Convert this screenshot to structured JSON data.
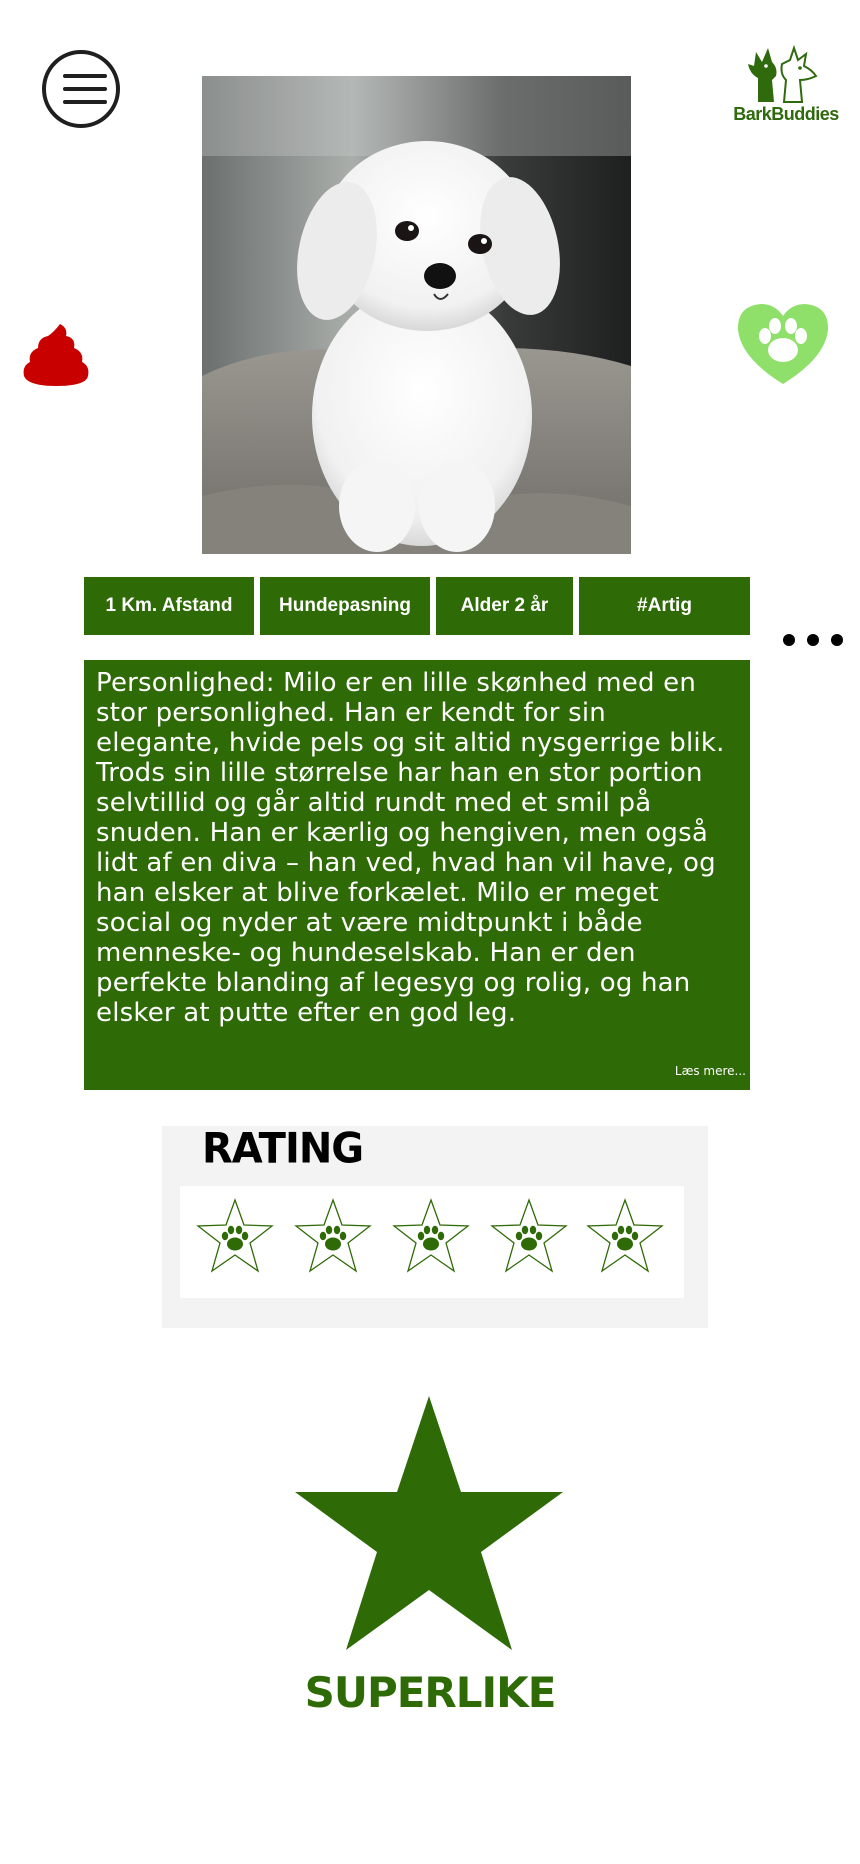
{
  "header": {
    "menu_icon": "hamburger-menu-icon",
    "logo_text": "BarkBuddies",
    "logo_color": "#2f6a0c"
  },
  "profile": {
    "photo_subject": "dog-photo",
    "tags": [
      {
        "label": "1 Km. Afstand"
      },
      {
        "label": "Hundepasning"
      },
      {
        "label": "Alder 2 år"
      },
      {
        "label": "#Artig"
      }
    ],
    "description": "Personlighed: Milo er en lille skønhed med en stor personlighed. Han er kendt for sin elegante, hvide pels og sit altid nysgerrige blik. Trods sin lille størrelse har han en stor portion selvtillid og går altid rundt med et smil på snuden. Han er kærlig og hengiven, men også lidt af en diva – han ved, hvad han vil have, og han elsker at blive forkælet. Milo er meget social og nyder at være midtpunkt i både menneske- og hundeselskab. Han er den perfekte blanding af legesyg og rolig, og han elsker at putte efter en god leg.",
    "read_more": "Læs mere..."
  },
  "actions": {
    "dislike_icon": "poop-icon",
    "dislike_color": "#c80000",
    "like_icon": "heart-paw-icon",
    "like_color": "#8fe06a"
  },
  "rating": {
    "title": "RATING",
    "star_count": 5,
    "star_icon": "paw-star-icon"
  },
  "superlike": {
    "label": "SUPERLIKE",
    "color": "#2e6a06"
  }
}
